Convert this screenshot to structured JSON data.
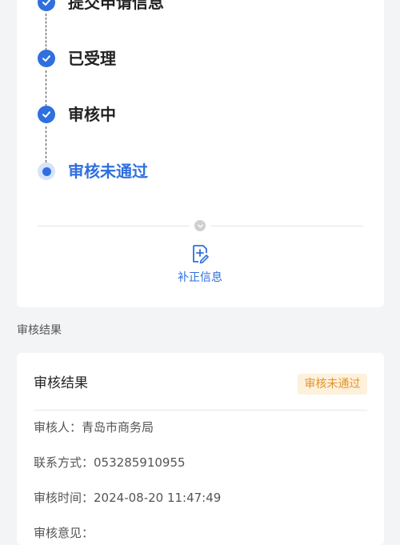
{
  "progress": {
    "steps": [
      {
        "label": "提交申请信息",
        "state": "done"
      },
      {
        "label": "已受理",
        "state": "done"
      },
      {
        "label": "审核中",
        "state": "done"
      },
      {
        "label": "审核未通过",
        "state": "current"
      }
    ],
    "supplement_label": "补正信息"
  },
  "section": {
    "title": "审核结果"
  },
  "result": {
    "title": "审核结果",
    "status": "审核未通过",
    "rows": [
      {
        "label": "审核人：",
        "value": "青岛市商务局"
      },
      {
        "label": "联系方式：",
        "value": "053285910955"
      },
      {
        "label": "审核时间：",
        "value": "2024-08-20 11:47:49"
      },
      {
        "label": "审核意见：",
        "value": ""
      }
    ]
  },
  "colors": {
    "accent": "#2f6fde",
    "warning": "#e2942c",
    "warning_bg": "#fdf1dc"
  }
}
